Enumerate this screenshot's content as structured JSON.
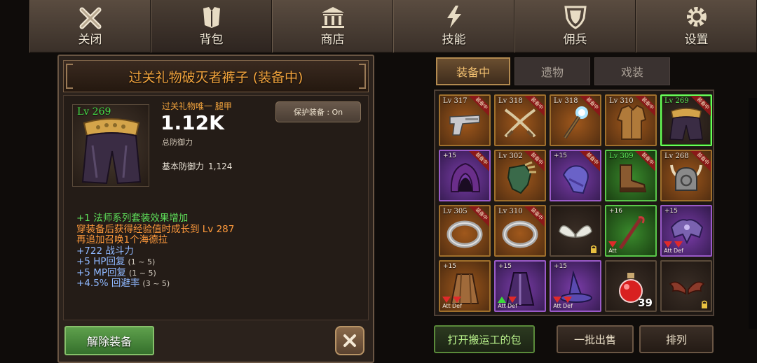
{
  "nav": {
    "tabs": [
      {
        "label": "关闭",
        "icon": "close-icon"
      },
      {
        "label": "背包",
        "icon": "armor-icon"
      },
      {
        "label": "商店",
        "icon": "bank-icon"
      },
      {
        "label": "技能",
        "icon": "lightning-icon"
      },
      {
        "label": "佣兵",
        "icon": "shield-icon"
      },
      {
        "label": "设置",
        "icon": "gear-icon"
      }
    ],
    "active": "背包"
  },
  "item": {
    "title": "过关礼物破灭者裤子 (装备中)",
    "level": "Lv 269",
    "kind": "过关礼物唯一  腿甲",
    "defense_value": "1.12K",
    "defense_label": "总防御力",
    "protect_button": "保护装备 : On",
    "base_defense_label": "基本防御力",
    "base_defense_value": "1,124",
    "bonuses": [
      {
        "text": "+1 法师系列套装效果增加",
        "color": "green",
        "range": ""
      },
      {
        "text": "穿装备后获得经验值时成长到 Lv 287",
        "color": "orange",
        "range": ""
      },
      {
        "text": "再追加召唤1个海德拉",
        "color": "orange",
        "range": ""
      },
      {
        "text": "+722 战斗力",
        "color": "blue",
        "range": ""
      },
      {
        "text": "+5 HP回复",
        "color": "blue",
        "range": "(1 ~ 5)"
      },
      {
        "text": "+5 MP回复",
        "color": "blue",
        "range": "(1 ~ 5)"
      },
      {
        "text": "+4.5% 回避率",
        "color": "blue",
        "range": "(3 ~ 5)"
      }
    ],
    "unequip_button": "解除装备"
  },
  "inventory": {
    "tabs": [
      "装备中",
      "遗物",
      "戏装"
    ],
    "active_tab": "装备中",
    "equipped_ribbon": "装备中",
    "slots": [
      {
        "top": "Lv 317",
        "top_color": "white",
        "rarity": "orange",
        "art": "pistol-icon",
        "ribbon": true
      },
      {
        "top": "Lv 318",
        "top_color": "white",
        "rarity": "orange",
        "art": "crossed-blades-icon",
        "ribbon": true
      },
      {
        "top": "Lv 318",
        "top_color": "white",
        "rarity": "orange",
        "art": "magic-staff-icon",
        "ribbon": true
      },
      {
        "top": "Lv 310",
        "top_color": "white",
        "rarity": "orange",
        "art": "tunic-icon",
        "ribbon": true
      },
      {
        "top": "Lv 269",
        "top_color": "green",
        "rarity": "selected",
        "art": "pants-icon",
        "ribbon": true
      },
      {
        "top": "+15",
        "top_color": "white",
        "rarity": "purple",
        "art": "hood-icon",
        "ribbon": true
      },
      {
        "top": "Lv 302",
        "top_color": "white",
        "rarity": "orange",
        "art": "gauntlet-icon",
        "ribbon": true
      },
      {
        "top": "+15",
        "top_color": "white",
        "rarity": "purple",
        "art": "cloth-glove-icon",
        "ribbon": true
      },
      {
        "top": "Lv 309",
        "top_color": "green",
        "rarity": "green",
        "art": "boots-icon",
        "ribbon": true
      },
      {
        "top": "Lv 268",
        "top_color": "white",
        "rarity": "orange",
        "art": "horned-helm-icon",
        "ribbon": true
      },
      {
        "top": "Lv 305",
        "top_color": "white",
        "rarity": "orange",
        "art": "ring-icon",
        "ribbon": true
      },
      {
        "top": "Lv 310",
        "top_color": "white",
        "rarity": "orange",
        "art": "ring-icon",
        "ribbon": true
      },
      {
        "top": "",
        "top_color": "white",
        "rarity": "plain",
        "art": "wings-icon",
        "ribbon": false,
        "lock": true
      },
      {
        "top": "+16",
        "top_color": "white",
        "rarity": "green",
        "art": "staff-icon",
        "ribbon": false,
        "arrows": [
          {
            "dir": "down",
            "label": "Att"
          }
        ]
      },
      {
        "top": "+15",
        "top_color": "white",
        "rarity": "purple",
        "art": "shoulder-armor-icon",
        "ribbon": false,
        "arrows": [
          {
            "dir": "down",
            "label": "Att"
          },
          {
            "dir": "down",
            "label": "Def"
          }
        ]
      },
      {
        "top": "+15",
        "top_color": "white",
        "rarity": "orange",
        "art": "cloak-icon",
        "ribbon": false,
        "arrows": [
          {
            "dir": "down",
            "label": "Att"
          },
          {
            "dir": "down",
            "label": "Def"
          }
        ]
      },
      {
        "top": "+15",
        "top_color": "white",
        "rarity": "purple",
        "art": "robe-icon",
        "ribbon": false,
        "arrows": [
          {
            "dir": "up",
            "label": "Att"
          },
          {
            "dir": "down",
            "label": "Def"
          }
        ]
      },
      {
        "top": "+15",
        "top_color": "white",
        "rarity": "purple",
        "art": "wizard-hat-icon",
        "ribbon": false,
        "arrows": [
          {
            "dir": "down",
            "label": "Att"
          },
          {
            "dir": "down",
            "label": "Def"
          }
        ]
      },
      {
        "top": "",
        "top_color": "white",
        "rarity": "plain",
        "art": "potion-icon",
        "ribbon": false,
        "qty": "39"
      },
      {
        "top": "",
        "top_color": "white",
        "rarity": "plain",
        "art": "bat-wings-icon",
        "ribbon": false,
        "lock": true
      }
    ]
  },
  "bottom": {
    "open_bag": "打开搬运工的包",
    "bulk_sell": "一批出售",
    "sort": "排列"
  },
  "colors": {
    "title_orange": "#f0a23c",
    "level_green": "#48e04a",
    "bonus_blue": "#8fb8ff",
    "panel_brown": "#2b221c"
  }
}
